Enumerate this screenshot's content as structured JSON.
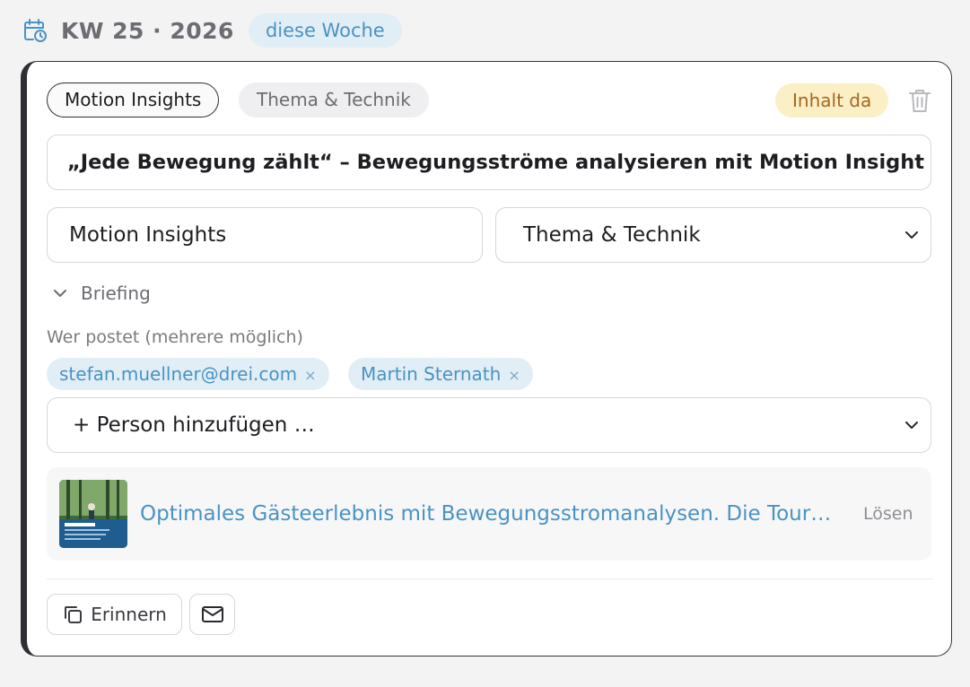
{
  "header": {
    "icon": "calendar-clock-icon",
    "week_label": "KW 25 · 2026",
    "week_badge": "diese Woche"
  },
  "card": {
    "category_pill": "Motion Insights",
    "topic_pill": "Thema & Technik",
    "status_badge": "Inhalt da",
    "title": "„Jede Bewegung zählt“ – Bewegungsströme analysieren mit Motion Insight",
    "product_field": "Motion Insights",
    "topic_select": "Thema & Technik",
    "briefing_label": "Briefing",
    "who_label": "Wer postet (mehrere möglich)",
    "posters": [
      {
        "name": "stefan.muellner@drei.com"
      },
      {
        "name": "Martin Sternath"
      }
    ],
    "remove_glyph": "×",
    "add_person": "+ Person hinzufügen …",
    "link": {
      "title": "Optimales Gästeerlebnis mit Bewegungsstromanalysen. Die Tour…",
      "unlink": "Lösen"
    },
    "remind_label": "Erinnern"
  },
  "colors": {
    "accent": "#4a93c2",
    "chip_bg": "#e1eef6",
    "status_bg": "#fbefc6",
    "status_text": "#a6671f"
  }
}
